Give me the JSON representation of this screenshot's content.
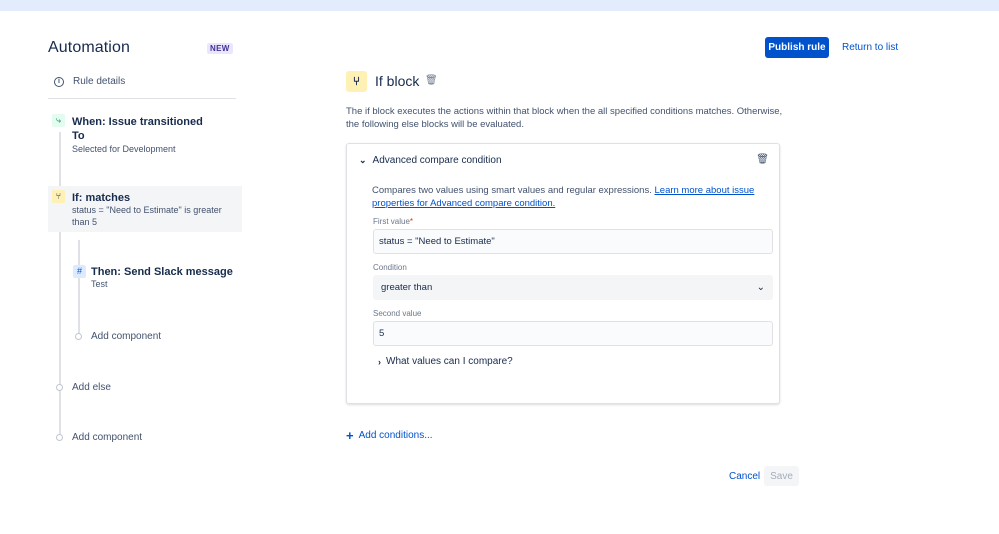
{
  "page": {
    "title": "Automation",
    "badge": "NEW",
    "rule_details": "Rule details"
  },
  "header": {
    "publish_label": "Publish rule",
    "return_label": "Return to list"
  },
  "flow": {
    "when": {
      "title": "When: Issue transitioned",
      "line2": "To",
      "detail": "Selected for Development"
    },
    "if": {
      "title": "If: matches",
      "detail": "status = \"Need to Estimate\" is greater than 5"
    },
    "then": {
      "title": "Then: Send Slack message",
      "detail": "Test"
    },
    "add_component_inner": "Add component",
    "add_else": "Add else",
    "add_component_outer": "Add component"
  },
  "block": {
    "title": "If block",
    "description": "The if block executes the actions within that block when the all specified conditions matches. Otherwise, the following else blocks will be evaluated."
  },
  "condition": {
    "title": "Advanced compare condition",
    "description": "Compares two values using smart values and regular expressions.",
    "learn_more": "Learn more about issue properties for Advanced compare condition.",
    "first_value_label": "First value",
    "required_mark": "*",
    "first_value": "status = \"Need to Estimate\"",
    "condition_label": "Condition",
    "condition_value": "greater than",
    "second_value_label": "Second value",
    "second_value": "5",
    "what_values": "What values can I compare?"
  },
  "actions": {
    "add_conditions": "Add conditions...",
    "cancel": "Cancel",
    "save": "Save"
  },
  "colors": {
    "primary": "#0052cc",
    "if_icon_bg": "#fff0b3",
    "when_icon_bg": "#e3fcef",
    "then_icon_bg": "#deebff"
  }
}
